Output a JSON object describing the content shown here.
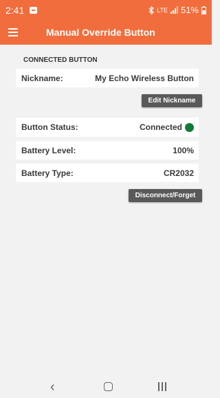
{
  "status_bar": {
    "time": "2:41",
    "network_label": "LTE",
    "battery_percent": "51%",
    "icons": [
      "notification-icon",
      "bluetooth-icon",
      "signal-icon",
      "battery-icon"
    ]
  },
  "app_bar": {
    "title": "Manual Override Button",
    "menu_icon": "hamburger-menu-icon"
  },
  "section": {
    "header": "CONNECTED BUTTON"
  },
  "nickname": {
    "label": "Nickname:",
    "value": "My Echo Wireless Button"
  },
  "edit_button": {
    "label": "Edit Nickname"
  },
  "button_status": {
    "label": "Button Status:",
    "value": "Connected",
    "indicator_color": "#137a3a"
  },
  "battery_level": {
    "label": "Battery Level:",
    "value": "100%"
  },
  "battery_type": {
    "label": "Battery Type:",
    "value": "CR2032"
  },
  "disconnect_button": {
    "label": "Disconnect/Forget"
  },
  "colors": {
    "accent": "#f26d3d",
    "button": "#595959",
    "background": "#f2f2f2"
  },
  "nav_bar": {
    "icons": [
      "back-icon",
      "home-icon",
      "recents-icon"
    ]
  }
}
